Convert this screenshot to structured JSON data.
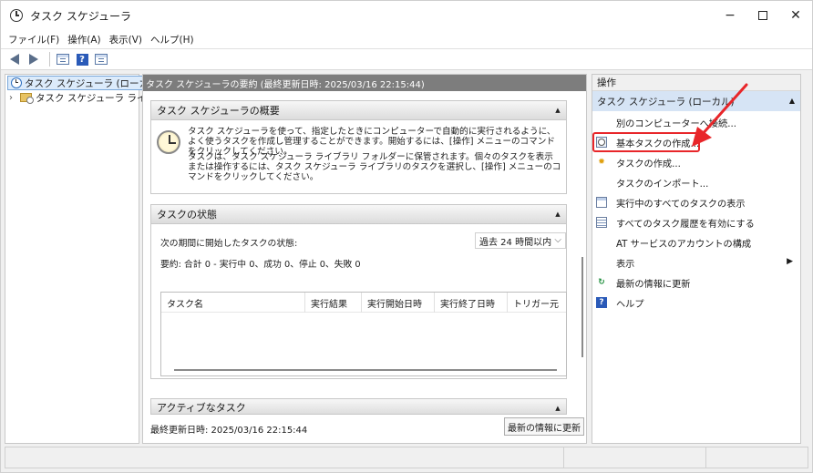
{
  "window": {
    "title": "タスク スケジューラ",
    "minimize": "−",
    "close": "✕"
  },
  "menubar": {
    "items": [
      "ファイル(F)",
      "操作(A)",
      "表示(V)",
      "ヘルプ(H)"
    ]
  },
  "toolbar": {
    "help_glyph": "?"
  },
  "tree": {
    "root_label": "タスク スケジューラ (ローカル)",
    "library_chevron": "›",
    "library_label": "タスク スケジューラ ライブラリ"
  },
  "center": {
    "header": "タスク スケジューラの要約 (最終更新日時: 2025/03/16 22:15:44)",
    "overview": {
      "title": "タスク スケジューラの概要",
      "collapse_glyph": "▲",
      "para1": "タスク スケジューラを使って、指定したときにコンピューターで自動的に実行されるように、よく使うタスクを作成し管理することができます。開始するには、[操作] メニューのコマンドをクリックしてください。",
      "para2": "タスクは、タスク スケジューラ ライブラリ フォルダーに保管されます。個々のタスクを表示または操作するには、タスク スケジューラ ライブラリのタスクを選択し、[操作] メニューのコマンドをクリックしてください。"
    },
    "status": {
      "title": "タスクの状態",
      "collapse_glyph": "▲",
      "period_label": "次の期間に開始したタスクの状態:",
      "period_value": "過去 24 時間以内",
      "dropdown_chevron": "⌵",
      "summary": "要約: 合計 0 - 実行中 0、成功 0、停止 0、失敗 0",
      "columns": [
        "タスク名",
        "実行結果",
        "実行開始日時",
        "実行終了日時",
        "トリガー元"
      ]
    },
    "active": {
      "title": "アクティブなタスク",
      "collapse_glyph": "▲"
    },
    "footer": {
      "last_updated": "最終更新日時: 2025/03/16 22:15:44",
      "refresh_button": "最新の情報に更新"
    }
  },
  "actions": {
    "title": "操作",
    "group": "タスク スケジューラ (ローカル)",
    "group_toggle": "▲",
    "items": [
      {
        "label": "別のコンピューターへ接続..."
      },
      {
        "label": "基本タスクの作成...",
        "icon": "basic-task-icon"
      },
      {
        "label": "タスクの作成...",
        "icon": "create-task-icon",
        "glyph": "✹"
      },
      {
        "label": "タスクのインポート..."
      },
      {
        "label": "実行中のすべてのタスクの表示",
        "icon": "running-tasks-icon"
      },
      {
        "label": "すべてのタスク履歴を有効にする",
        "icon": "history-icon"
      },
      {
        "label": "AT サービスのアカウントの構成"
      },
      {
        "label": "表示",
        "submenu": "▶"
      },
      {
        "label": "最新の情報に更新",
        "icon": "refresh-icon",
        "glyph": "↻"
      },
      {
        "label": "ヘルプ",
        "icon": "help-icon",
        "glyph": "?"
      }
    ]
  },
  "colors": {
    "highlight": "#e8262a",
    "selection": "#dcebfb",
    "actions_group": "#d6e4f5"
  }
}
